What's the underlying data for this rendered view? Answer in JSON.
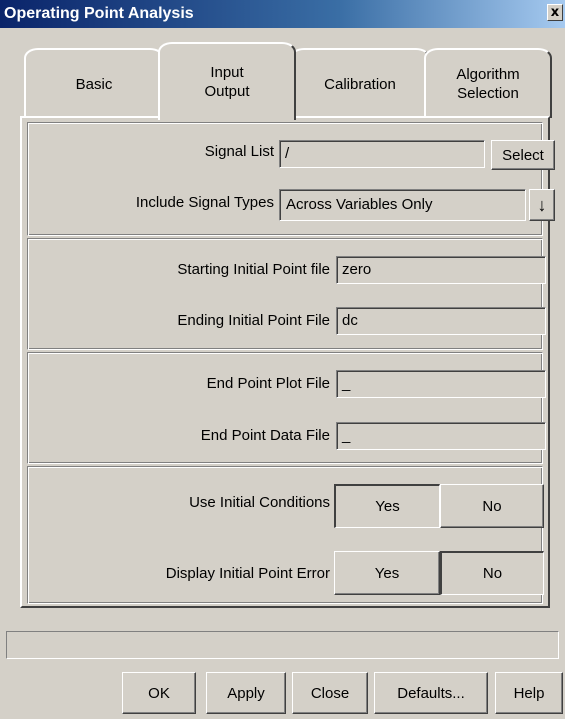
{
  "window": {
    "title": "Operating Point Analysis",
    "close_label": "x"
  },
  "tabs": [
    {
      "label": "Basic",
      "active": false
    },
    {
      "label": "Input\nOutput",
      "active": true
    },
    {
      "label": "Calibration",
      "active": false
    },
    {
      "label": "Algorithm\nSelection",
      "active": false
    }
  ],
  "signals": {
    "signal_list_label": "Signal List",
    "signal_list_value": "/",
    "select_button": "Select",
    "include_types_label": "Include Signal Types",
    "include_types_value": "Across Variables Only",
    "dropdown_arrow": "↓"
  },
  "initial_point": {
    "starting_label": "Starting Initial Point file",
    "starting_value": "zero",
    "ending_label": "Ending Initial Point File",
    "ending_value": "dc"
  },
  "end_point": {
    "plot_label": "End Point Plot File",
    "plot_value": "_",
    "data_label": "End Point Data File",
    "data_value": "_"
  },
  "options": {
    "use_initial_label": "Use Initial Conditions",
    "use_initial_yes": "Yes",
    "use_initial_no": "No",
    "use_initial_selected": "Yes",
    "display_error_label": "Display Initial Point Error",
    "display_error_yes": "Yes",
    "display_error_no": "No",
    "display_error_selected": "No"
  },
  "footer": {
    "status_text": "",
    "ok": "OK",
    "apply": "Apply",
    "close": "Close",
    "defaults": "Defaults...",
    "help": "Help"
  }
}
